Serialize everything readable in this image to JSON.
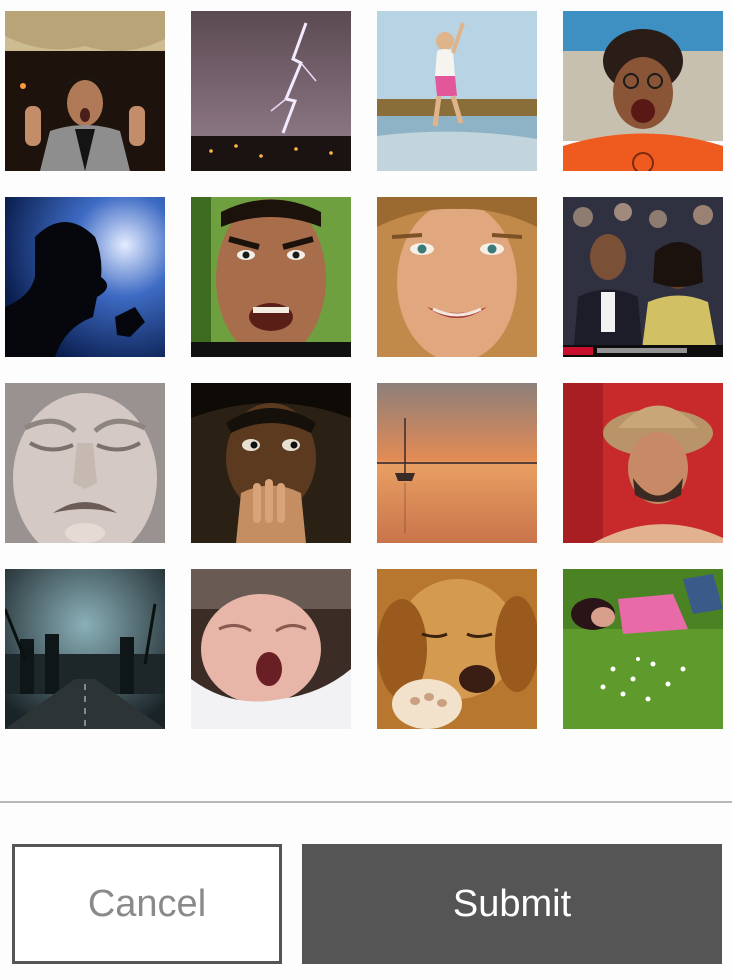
{
  "grid": {
    "images": [
      {
        "name": "surprised-man-photo"
      },
      {
        "name": "lightning-storm-photo"
      },
      {
        "name": "jumping-girl-beach-photo"
      },
      {
        "name": "shouting-woman-beach-photo"
      },
      {
        "name": "silhouette-screaming-man-photo"
      },
      {
        "name": "angry-man-green-photo"
      },
      {
        "name": "smiling-girl-photo"
      },
      {
        "name": "crowd-couple-tv-photo"
      },
      {
        "name": "crying-mask-photo"
      },
      {
        "name": "nervous-boy-photo"
      },
      {
        "name": "sunset-boat-photo"
      },
      {
        "name": "man-straw-hat-photo"
      },
      {
        "name": "stormy-factory-road-photo"
      },
      {
        "name": "yawning-baby-photo"
      },
      {
        "name": "sleeping-dog-photo"
      },
      {
        "name": "girl-lying-grass-photo"
      }
    ]
  },
  "actions": {
    "cancel_label": "Cancel",
    "submit_label": "Submit"
  },
  "colors": {
    "button_dark": "#555555",
    "cancel_text": "#8a8a8a",
    "divider": "#b8b8b8",
    "background": "#fdfdfd"
  }
}
